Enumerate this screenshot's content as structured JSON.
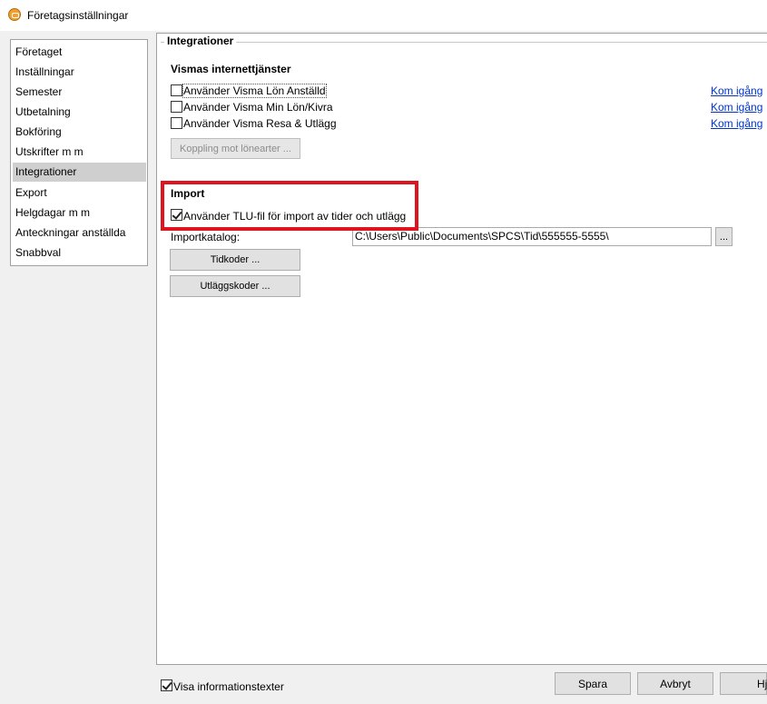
{
  "window": {
    "title": "Företagsinställningar"
  },
  "nav": {
    "items": [
      {
        "label": "Företaget"
      },
      {
        "label": "Inställningar"
      },
      {
        "label": "Semester"
      },
      {
        "label": "Utbetalning"
      },
      {
        "label": "Bokföring"
      },
      {
        "label": "Utskrifter m m"
      },
      {
        "label": "Integrationer",
        "selected": true
      },
      {
        "label": "Export"
      },
      {
        "label": "Helgdagar m m"
      },
      {
        "label": "Anteckningar anställda"
      },
      {
        "label": "Snabbval"
      }
    ]
  },
  "panel": {
    "group_title": "Integrationer",
    "visma": {
      "title": "Vismas internettjänster",
      "options": [
        {
          "label": "Använder Visma Lön Anställd",
          "checked": false,
          "link": "Kom igång"
        },
        {
          "label": "Använder Visma Min Lön/Kivra",
          "checked": false,
          "link": "Kom igång"
        },
        {
          "label": "Använder Visma Resa & Utlägg",
          "checked": false,
          "link": "Kom igång"
        }
      ],
      "koppling_button": "Koppling mot lönearter ..."
    },
    "import": {
      "title": "Import",
      "tlu_label": "Använder TLU-fil för import av tider och utlägg",
      "tlu_checked": true,
      "katalog_label": "Importkatalog:",
      "katalog_value": "C:\\Users\\Public\\Documents\\SPCS\\Tid\\555555-5555\\",
      "browse_button": "...",
      "tidkoder_button": "Tidkoder ...",
      "utlaggskoder_button": "Utläggskoder ..."
    }
  },
  "footer": {
    "info_label": "Visa informationstexter",
    "info_checked": true,
    "save_button": "Spara",
    "cancel_button": "Avbryt",
    "help_button": "Hj"
  },
  "colors": {
    "highlight": "#e0141e",
    "link": "#0033cc",
    "selected_nav": "#cfcfcf"
  }
}
